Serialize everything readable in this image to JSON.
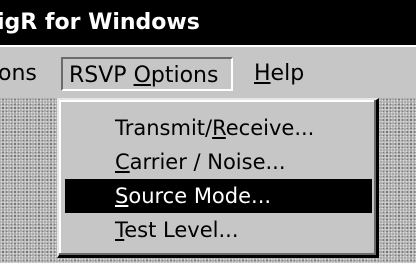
{
  "window": {
    "title": "igR for Windows"
  },
  "menubar": {
    "items": [
      {
        "label": "ons",
        "underline_index": -1
      },
      {
        "label_pre": "RSVP ",
        "label_u": "O",
        "label_post": "ptions"
      },
      {
        "label_u": "H",
        "label_post": "elp"
      }
    ]
  },
  "dropdown": {
    "items": [
      {
        "pre": "Transmit/",
        "u": "R",
        "post": "eceive...",
        "selected": false
      },
      {
        "pre": "",
        "u": "C",
        "post": "arrier / Noise...",
        "selected": false
      },
      {
        "pre": "",
        "u": "S",
        "post": "ource Mode...",
        "selected": true
      },
      {
        "pre": "",
        "u": "T",
        "post": "est Level...",
        "selected": false
      }
    ]
  }
}
